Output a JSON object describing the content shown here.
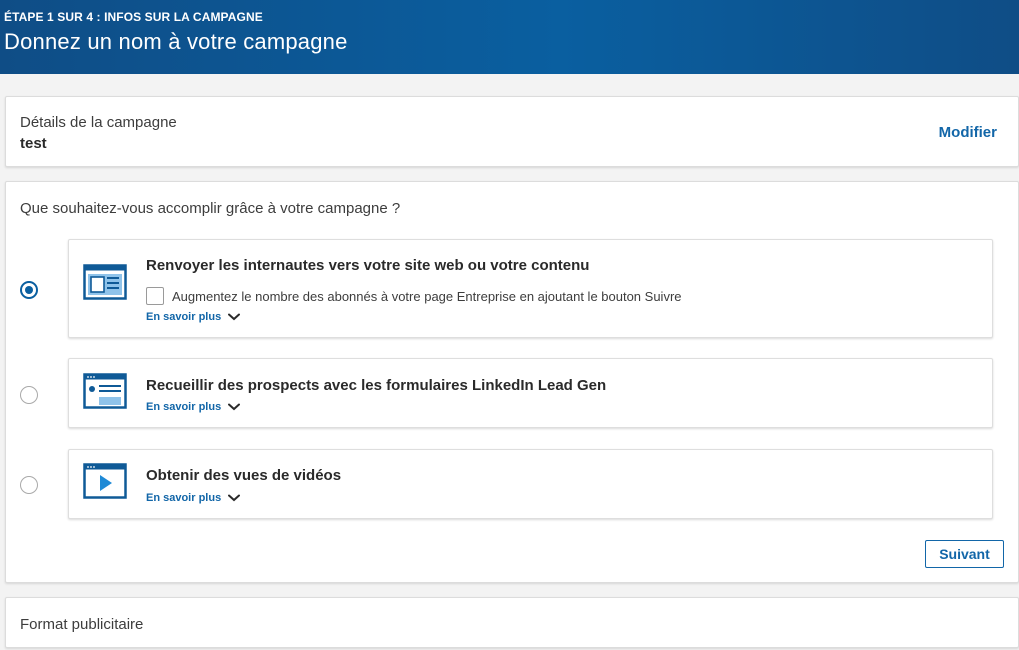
{
  "header": {
    "step": "ÉTAPE 1 SUR 4 : INFOS SUR LA CAMPAGNE",
    "title": "Donnez un nom à votre campagne"
  },
  "details": {
    "label": "Détails de la campagne",
    "value": "test",
    "modify_label": "Modifier"
  },
  "objective": {
    "question": "Que souhaitez-vous accomplir grâce à votre campagne ?",
    "options": [
      {
        "title": "Renvoyer les internautes vers votre site web ou votre contenu",
        "icon": "website-visits-icon",
        "selected": true,
        "checkbox_label": "Augmentez le nombre des abonnés à votre page Entreprise en ajoutant le bouton Suivre",
        "checkbox_checked": false,
        "more_label": "En savoir plus"
      },
      {
        "title": "Recueillir des prospects avec les formulaires LinkedIn Lead Gen",
        "icon": "lead-gen-form-icon",
        "selected": false,
        "more_label": "En savoir plus"
      },
      {
        "title": "Obtenir des vues de vidéos",
        "icon": "video-views-icon",
        "selected": false,
        "more_label": "En savoir plus"
      }
    ],
    "next_label": "Suivant"
  },
  "format": {
    "label": "Format publicitaire"
  },
  "colors": {
    "brand_blue": "#0a5fa0",
    "link_blue": "#1266a8"
  }
}
